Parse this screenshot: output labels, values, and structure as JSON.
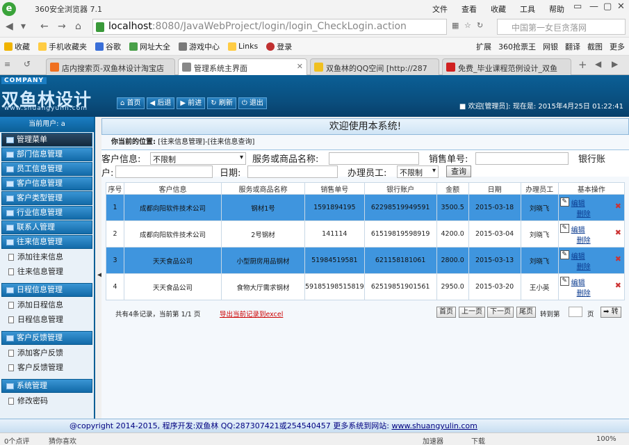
{
  "browser": {
    "title": "360安全浏览器 7.1",
    "logo": "e",
    "menus": [
      "文件",
      "查看",
      "收藏",
      "工具",
      "帮助"
    ],
    "url_host": "localhost",
    "url_rest": ":8080/JavaWebProject/login/login_CheckLogin.action",
    "search_placeholder": "中国第一女巨贪落网",
    "favorites": [
      "收藏",
      "手机收藏夹",
      "谷歌",
      "网址大全",
      "游戏中心",
      "Links",
      "登录"
    ],
    "toolbar_right": [
      "扩展",
      "360抢票王",
      "网银",
      "翻译",
      "截图",
      "更多"
    ],
    "tabs": [
      "店内搜索页-双鱼林设计淘宝店",
      "管理系统主界面",
      "双鱼林的QQ空间 [http://287",
      "免费_毕业课程范例设计_双鱼"
    ]
  },
  "header": {
    "company": "COMPANY",
    "logo_text": "双鱼林设计",
    "logo_url": "www.shuangyulin.com",
    "nav": [
      "首页",
      "后退",
      "前进",
      "刷新",
      "退出"
    ],
    "welcome": "■ 欢迎[管理员]: 现在是: 2015年4月25日 01:22:41"
  },
  "sidebar": {
    "current_user": "当前用户: a",
    "menu_title": "管理菜单",
    "sections": [
      {
        "label": "部门信息管理"
      },
      {
        "label": "员工信息管理"
      },
      {
        "label": "客户信息管理"
      },
      {
        "label": "客户类型管理"
      },
      {
        "label": "行业信息管理"
      },
      {
        "label": "联系人管理"
      },
      {
        "label": "往来信息管理"
      }
    ],
    "sub_wanglai": [
      "添加往来信息",
      "往来信息管理"
    ],
    "schedule_head": "日程信息管理",
    "sub_schedule": [
      "添加日程信息",
      "日程信息管理"
    ],
    "feedback_head": "客户反馈管理",
    "sub_feedback": [
      "添加客户反馈",
      "客户反馈管理"
    ],
    "system_head": "系统管理",
    "sub_system": [
      "修改密码"
    ]
  },
  "main": {
    "title": "欢迎使用本系统!",
    "location_label": "你当前的位置:",
    "location_path": "[往来信息管理]-[往来信息查询]",
    "filter": {
      "customer_label": "客户信息:",
      "customer_value": "不限制",
      "product_label": "服务或商品名称:",
      "sale_no_label": "销售单号:",
      "bank_label": "银行账",
      "bank_label2": "户:",
      "date_label": "日期:",
      "employee_label": "办理员工:",
      "employee_value": "不限制",
      "query_button": "查询"
    },
    "columns": [
      "序号",
      "客户信息",
      "服务或商品名称",
      "销售单号",
      "银行账户",
      "金额",
      "日期",
      "办理员工",
      "基本操作"
    ],
    "rows": [
      {
        "no": "1",
        "customer": "成都向阳软件技术公司",
        "product": "钢材1号",
        "sale_no": "1591894195",
        "account": "62298519949591",
        "amount": "3500.5",
        "date": "2015-03-18",
        "employee": "刘晓飞",
        "edit": "编辑",
        "delete": "删除",
        "highlight": true
      },
      {
        "no": "2",
        "customer": "成都向阳软件技术公司",
        "product": "2号钢材",
        "sale_no": "141114",
        "account": "61519819598919",
        "amount": "4200.0",
        "date": "2015-03-04",
        "employee": "刘晓飞",
        "edit": "编辑",
        "delete": "删除",
        "highlight": false
      },
      {
        "no": "3",
        "customer": "天天食品公司",
        "product": "小型厨房用品钢材",
        "sale_no": "51984519581",
        "account": "621158181061",
        "amount": "2800.0",
        "date": "2015-03-13",
        "employee": "刘晓飞",
        "edit": "编辑",
        "delete": "删除",
        "highlight": true
      },
      {
        "no": "4",
        "customer": "天天食品公司",
        "product": "食物大厅需求钢材",
        "sale_no": "59185198515819",
        "account": "62519851901561",
        "amount": "2950.0",
        "date": "2015-03-20",
        "employee": "王小英",
        "edit": "编辑",
        "delete": "删除",
        "highlight": false
      }
    ],
    "pager": {
      "info": "共有4条记录，当前第 1/1 页",
      "export": "导出当前记录到excel",
      "buttons": [
        "首页",
        "上一页",
        "下一页",
        "尾页"
      ],
      "goto": "转到第",
      "page_unit": "页",
      "go": "转"
    }
  },
  "footer": {
    "text": "@copyright 2014-2015, 程序开发:双鱼林   QQ:287307421或254540457   更多系统到网站: ",
    "site": "www.shuangyulin.com"
  },
  "statusbar": {
    "left": "0个点评",
    "like": "猜你喜欢",
    "accelerator": "加速器",
    "download": "下载",
    "zoom": "100%"
  }
}
